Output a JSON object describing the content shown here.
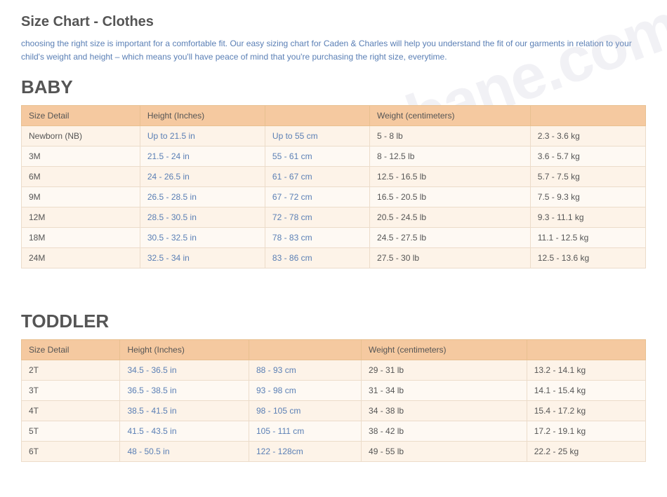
{
  "page": {
    "title": "Size Chart - Clothes",
    "intro": "choosing the right size is important for a comfortable fit. Our easy sizing chart for Caden & Charles will help you understand the fit of our garments in relation to your child's weight and height – which means you'll have peace of mind that you're purchasing the right size, everytime."
  },
  "baby": {
    "section_title": "BABY",
    "columns": [
      "Size Detail",
      "Height (Inches)",
      "",
      "Weight (centimeters)",
      ""
    ],
    "rows": [
      [
        "Newborn (NB)",
        "Up to 21.5 in",
        "Up to 55 cm",
        "5 - 8 lb",
        "2.3 - 3.6 kg"
      ],
      [
        "3M",
        "21.5 - 24 in",
        "55 - 61 cm",
        "8 - 12.5 lb",
        "3.6 - 5.7 kg"
      ],
      [
        "6M",
        "24 - 26.5 in",
        "61 - 67 cm",
        "12.5 - 16.5 lb",
        "5.7 - 7.5 kg"
      ],
      [
        "9M",
        "26.5 - 28.5 in",
        "67 - 72 cm",
        "16.5 - 20.5 lb",
        "7.5 - 9.3 kg"
      ],
      [
        "12M",
        "28.5 - 30.5 in",
        "72 - 78 cm",
        "20.5 - 24.5 lb",
        "9.3 - 11.1 kg"
      ],
      [
        "18M",
        "30.5 - 32.5 in",
        "78 - 83 cm",
        "24.5 - 27.5 lb",
        "11.1 - 12.5 kg"
      ],
      [
        "24M",
        "32.5 - 34 in",
        "83 - 86 cm",
        "27.5 - 30 lb",
        "12.5 - 13.6 kg"
      ]
    ]
  },
  "toddler": {
    "section_title": "TODDLER",
    "columns": [
      "Size Detail",
      "Height (Inches)",
      "",
      "Weight (centimeters)",
      ""
    ],
    "rows": [
      [
        "2T",
        "34.5 - 36.5 in",
        "88 - 93 cm",
        "29 - 31 lb",
        "13.2 - 14.1 kg"
      ],
      [
        "3T",
        "36.5 - 38.5 in",
        "93 - 98 cm",
        "31 - 34 lb",
        "14.1 - 15.4 kg"
      ],
      [
        "4T",
        "38.5 - 41.5 in",
        "98 - 105 cm",
        "34 - 38 lb",
        "15.4 - 17.2 kg"
      ],
      [
        "5T",
        "41.5 - 43.5 in",
        "105 - 111 cm",
        "38 - 42 lb",
        "17.2 - 19.1 kg"
      ],
      [
        "6T",
        "48 - 50.5 in",
        "122 - 128cm",
        "49 - 55 lb",
        "22.2 - 25 kg"
      ]
    ]
  }
}
